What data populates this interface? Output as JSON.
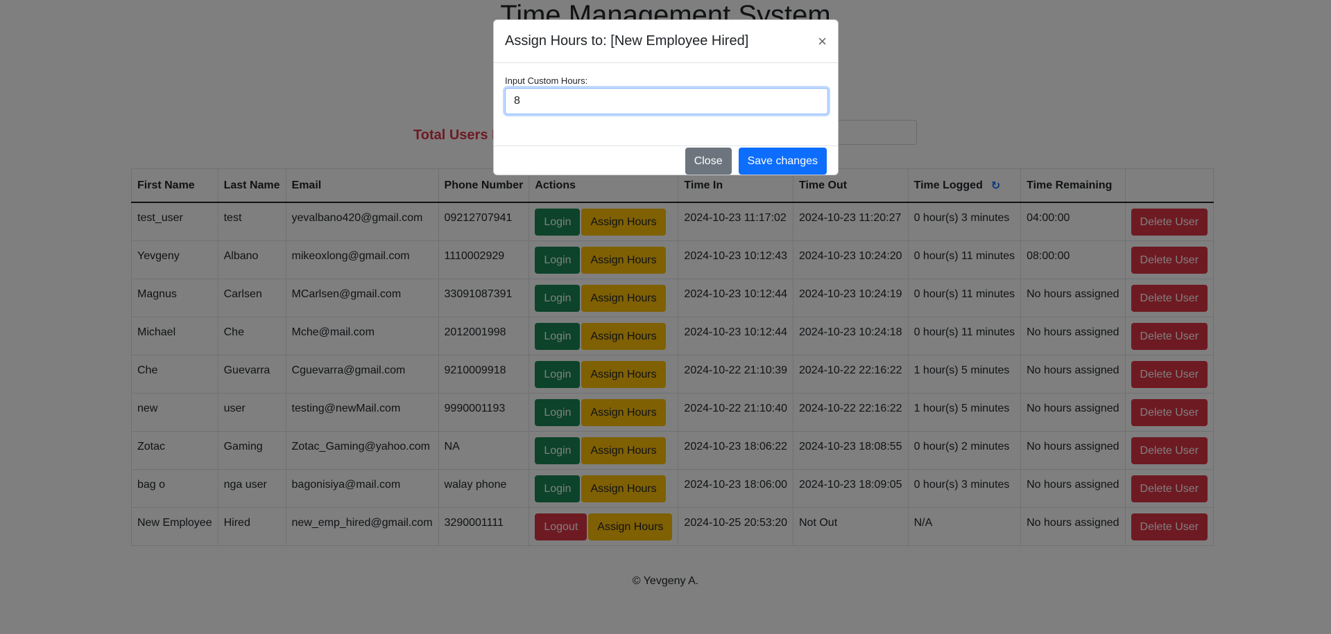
{
  "app": {
    "title": "Time Management System",
    "total_users_label": "Total Users L",
    "search_placeholder": "..."
  },
  "table": {
    "headers": [
      "First Name",
      "Last Name",
      "Email",
      "Phone Number",
      "Actions",
      "Time In",
      "Time Out",
      "Time Logged",
      "Time Remaining",
      ""
    ],
    "assign_label": "Assign Hours",
    "delete_label": "Delete User",
    "rows": [
      {
        "first": "test_user",
        "last": "test",
        "email": "yevalbano420@gmail.com",
        "phone": "09212707941",
        "action": "Login",
        "time_in": "2024-10-23 11:17:02",
        "time_out": "2024-10-23 11:20:27",
        "logged": "0 hour(s) 3 minutes",
        "remaining": "04:00:00"
      },
      {
        "first": "Yevgeny",
        "last": "Albano",
        "email": "mikeoxlong@gmail.com",
        "phone": "1110002929",
        "action": "Login",
        "time_in": "2024-10-23 10:12:43",
        "time_out": "2024-10-23 10:24:20",
        "logged": "0 hour(s) 11 minutes",
        "remaining": "08:00:00"
      },
      {
        "first": "Magnus",
        "last": "Carlsen",
        "email": "MCarlsen@gmail.com",
        "phone": "33091087391",
        "action": "Login",
        "time_in": "2024-10-23 10:12:44",
        "time_out": "2024-10-23 10:24:19",
        "logged": "0 hour(s) 11 minutes",
        "remaining": "No hours assigned"
      },
      {
        "first": "Michael",
        "last": "Che",
        "email": "Mche@mail.com",
        "phone": "2012001998",
        "action": "Login",
        "time_in": "2024-10-23 10:12:44",
        "time_out": "2024-10-23 10:24:18",
        "logged": "0 hour(s) 11 minutes",
        "remaining": "No hours assigned"
      },
      {
        "first": "Che",
        "last": "Guevarra",
        "email": "Cguevarra@gmail.com",
        "phone": "9210009918",
        "action": "Login",
        "time_in": "2024-10-22 21:10:39",
        "time_out": "2024-10-22 22:16:22",
        "logged": "1 hour(s) 5 minutes",
        "remaining": "No hours assigned"
      },
      {
        "first": "new",
        "last": "user",
        "email": "testing@newMail.com",
        "phone": "9990001193",
        "action": "Login",
        "time_in": "2024-10-22 21:10:40",
        "time_out": "2024-10-22 22:16:22",
        "logged": "1 hour(s) 5 minutes",
        "remaining": "No hours assigned"
      },
      {
        "first": "Zotac",
        "last": "Gaming",
        "email": "Zotac_Gaming@yahoo.com",
        "phone": "NA",
        "action": "Login",
        "time_in": "2024-10-23 18:06:22",
        "time_out": "2024-10-23 18:08:55",
        "logged": "0 hour(s) 2 minutes",
        "remaining": "No hours assigned"
      },
      {
        "first": "bag o",
        "last": "nga user",
        "email": "bagonisiya@mail.com",
        "phone": "walay phone",
        "action": "Login",
        "time_in": "2024-10-23 18:06:00",
        "time_out": "2024-10-23 18:09:05",
        "logged": "0 hour(s) 3 minutes",
        "remaining": "No hours assigned"
      },
      {
        "first": "New Employee",
        "last": "Hired",
        "email": "new_emp_hired@gmail.com",
        "phone": "3290001111",
        "action": "Logout",
        "time_in": "2024-10-25 20:53:20",
        "time_out": "Not Out",
        "logged": "N/A",
        "remaining": "No hours assigned"
      }
    ]
  },
  "footer": {
    "text": "© Yevgeny A."
  },
  "modal": {
    "title": "Assign Hours to: [New Employee Hired]",
    "close_glyph": "×",
    "field_label": "Input Custom Hours:",
    "field_value": "8",
    "close_button": "Close",
    "save_button": "Save changes"
  },
  "colors": {
    "login": "#198754",
    "logout": "#dc3545",
    "assign": "#ffc107",
    "delete": "#dc3545",
    "primary": "#0d6efd",
    "secondary": "#6c757d"
  },
  "icons": {
    "refresh": "refresh-icon"
  }
}
